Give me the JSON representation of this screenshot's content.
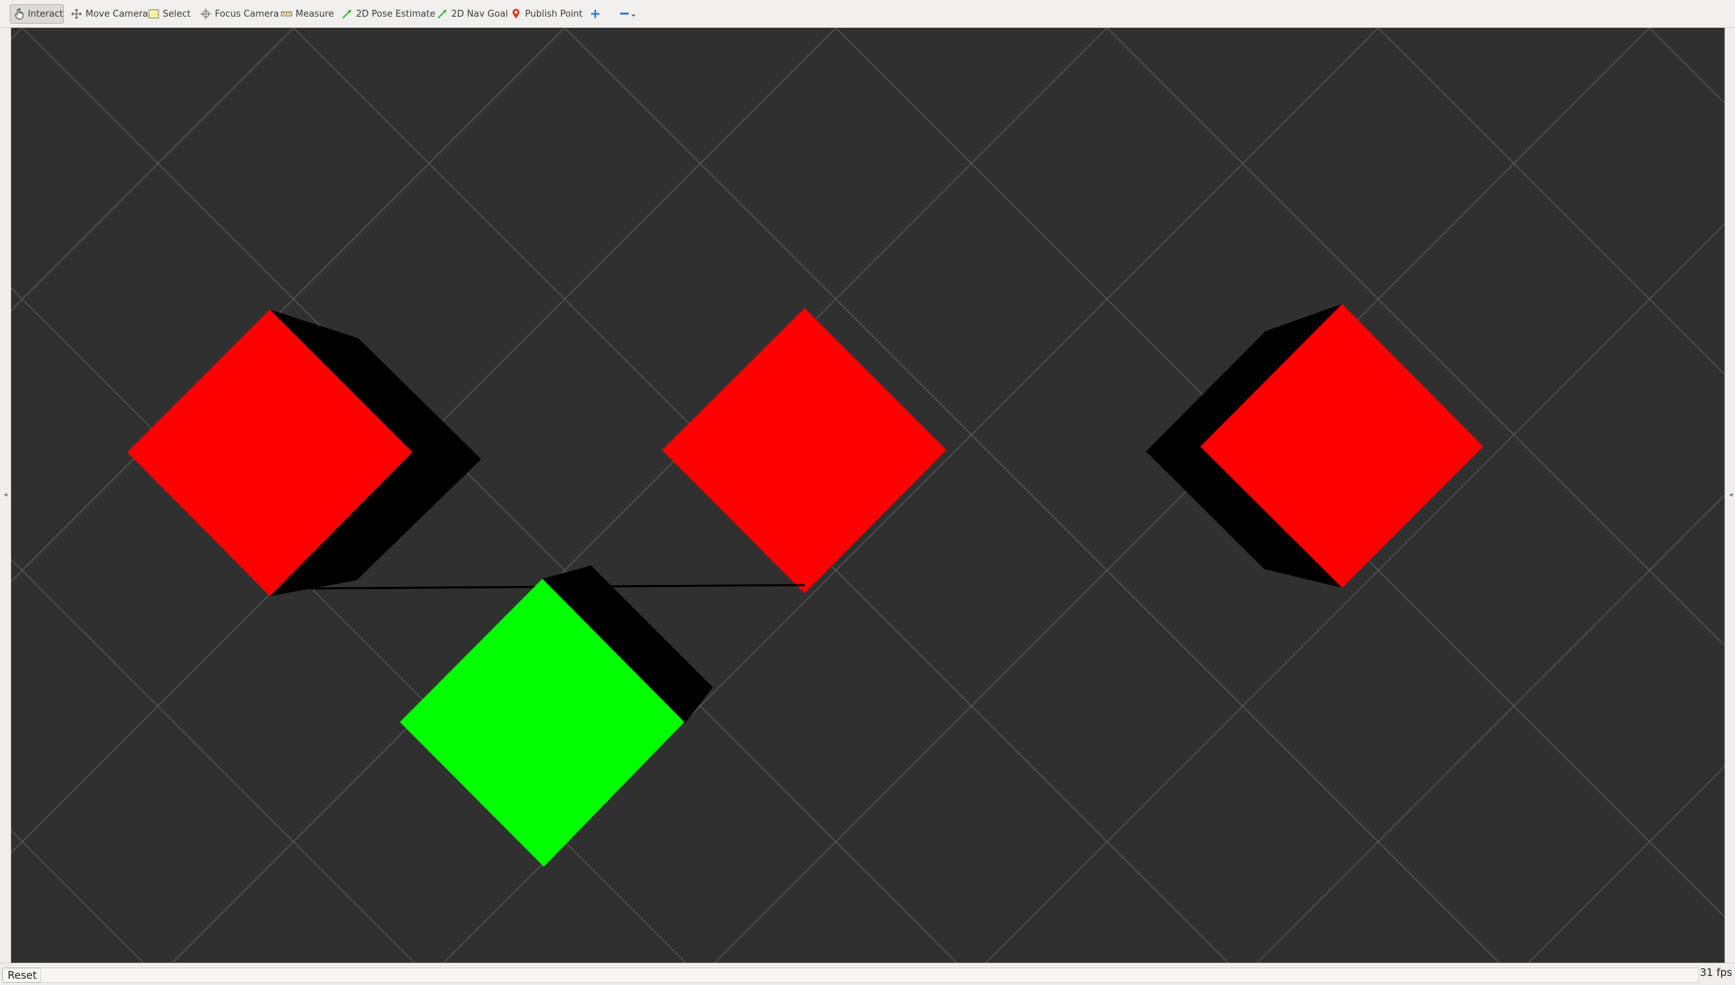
{
  "toolbar": {
    "tools": [
      {
        "label": "Interact",
        "icon": "hand-cursor-icon",
        "active": true
      },
      {
        "label": "Move Camera",
        "icon": "move-camera-icon",
        "active": false
      },
      {
        "label": "Select",
        "icon": "select-rectangle-icon",
        "active": false
      },
      {
        "label": "Focus Camera",
        "icon": "focus-crosshair-icon",
        "active": false
      },
      {
        "label": "Measure",
        "icon": "ruler-icon",
        "active": false
      },
      {
        "label": "2D Pose Estimate",
        "icon": "green-arrow-icon",
        "active": false
      },
      {
        "label": "2D Nav Goal",
        "icon": "green-arrow-icon",
        "active": false
      },
      {
        "label": "Publish Point",
        "icon": "map-pin-icon",
        "active": false
      }
    ],
    "add_tool_icon": "plus-icon",
    "remove_tool_icon": "minus-dropdown-icon"
  },
  "viewport": {
    "background_color": "#303030",
    "grid_color": "#5e5e5e",
    "markers": [
      {
        "name": "left-cube",
        "color": "#ff0000",
        "shadow": "#000000"
      },
      {
        "name": "center-cube",
        "color": "#ff0000",
        "shadow": "#000000"
      },
      {
        "name": "right-cube",
        "color": "#ff0000",
        "shadow": "#000000"
      },
      {
        "name": "green-cube",
        "color": "#00ff00",
        "shadow": "#000000"
      }
    ]
  },
  "status": {
    "reset_label": "Reset",
    "fps_label": "31 fps"
  },
  "colors": {
    "toolbar_bg": "#f1f0ef",
    "panel_bg": "#efeeed",
    "accent_green": "#2fb82f",
    "pin_red": "#d0402a"
  }
}
